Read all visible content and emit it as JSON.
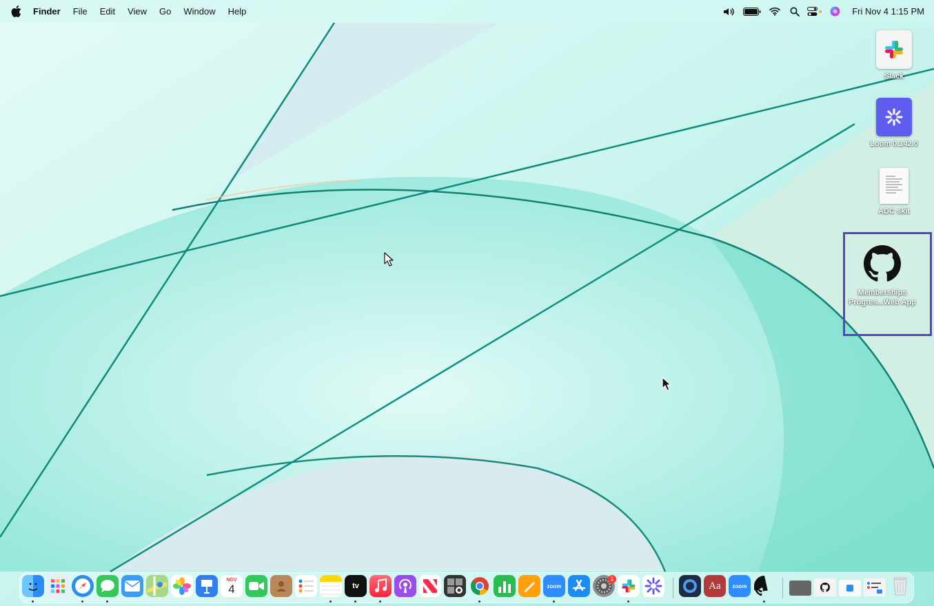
{
  "menubar": {
    "app_name": "Finder",
    "menus": [
      "File",
      "Edit",
      "View",
      "Go",
      "Window",
      "Help"
    ],
    "status_icons": [
      "volume-icon",
      "battery-icon",
      "wifi-icon",
      "spotlight-icon",
      "control-center-icon",
      "siri-icon"
    ],
    "clock": "Fri Nov 4  1:15 PM"
  },
  "desktop": {
    "icons": [
      {
        "name": "slack",
        "label": "Slack",
        "icon": "slack-icon"
      },
      {
        "name": "loom",
        "label": "Loom 0.142.0",
        "icon": "loom-icon"
      },
      {
        "name": "adc-skit",
        "label": "ADC skit",
        "icon": "document-icon"
      },
      {
        "name": "memberships",
        "label_line1": "Memberships",
        "label_line2": "Progres...Web App",
        "icon": "github-icon",
        "selected": true
      }
    ],
    "selection_color": "#5b3fd1"
  },
  "dock": {
    "apps": [
      "Finder",
      "Launchpad",
      "Safari",
      "Messages",
      "Mail",
      "Maps",
      "Photos",
      "Keynote",
      "Calendar",
      "FaceTime",
      "Contacts",
      "Reminders",
      "Notes",
      "Apple TV",
      "Music",
      "Podcasts",
      "News",
      "Photo Booth",
      "Google Chrome",
      "Numbers",
      "Pages",
      "Zoom",
      "App Store",
      "System Preferences",
      "Slack",
      "Loom",
      "Proxyman",
      "Dictionary",
      "Zoom",
      "GitHub Desktop",
      "Screenshot",
      "Documents",
      "Downloads",
      "Recents",
      "Trash"
    ],
    "calendar_month": "NOV",
    "calendar_day": "4",
    "appletv_label": "tv",
    "zoom_label": "zoom",
    "dictionary_label": "Aa",
    "sysprefs_badge": "1"
  },
  "colors": {
    "wallpaper_light": "#d8f7f2",
    "wallpaper_mid": "#7fe0d0",
    "wallpaper_dark": "#18a294"
  }
}
